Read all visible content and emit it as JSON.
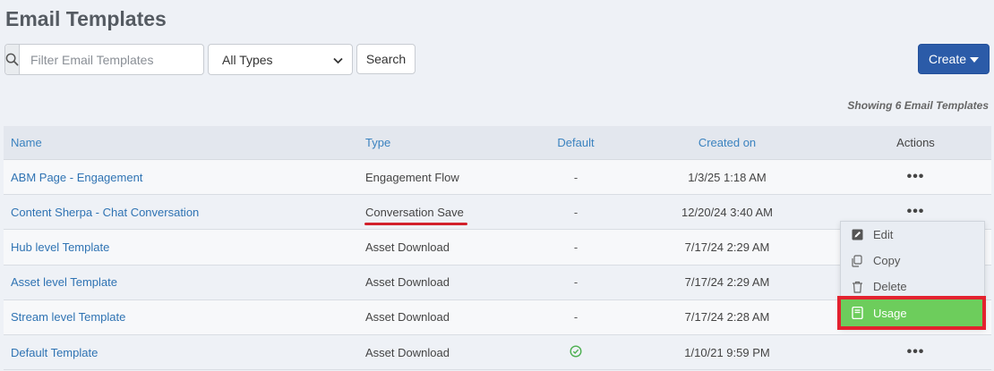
{
  "page": {
    "title": "Email Templates"
  },
  "toolbar": {
    "search_placeholder": "Filter Email Templates",
    "type_select_value": "All Types",
    "search_label": "Search",
    "create_label": "Create"
  },
  "count_text": "Showing 6 Email Templates",
  "table": {
    "headers": {
      "name": "Name",
      "type": "Type",
      "default": "Default",
      "created": "Created on",
      "actions": "Actions"
    },
    "rows": [
      {
        "name": "ABM Page - Engagement",
        "type": "Engagement Flow",
        "default": "-",
        "created": "1/3/25 1:18 AM",
        "actions": "•••"
      },
      {
        "name": "Content Sherpa - Chat Conversation",
        "type": "Conversation Save",
        "default": "-",
        "created": "12/20/24 3:40 AM",
        "actions": "•••"
      },
      {
        "name": "Hub level Template",
        "type": "Asset Download",
        "default": "-",
        "created": "7/17/24 2:29 AM",
        "actions": ""
      },
      {
        "name": "Asset level Template",
        "type": "Asset Download",
        "default": "-",
        "created": "7/17/24 2:29 AM",
        "actions": ""
      },
      {
        "name": "Stream level Template",
        "type": "Asset Download",
        "default": "-",
        "created": "7/17/24 2:28 AM",
        "actions": ""
      },
      {
        "name": "Default Template",
        "type": "Asset Download",
        "default": "",
        "created": "1/10/21 9:59 PM",
        "actions": "•••"
      }
    ]
  },
  "menu": {
    "items": [
      {
        "label": "Edit",
        "icon": "edit-icon"
      },
      {
        "label": "Copy",
        "icon": "copy-icon"
      },
      {
        "label": "Delete",
        "icon": "trash-icon"
      },
      {
        "label": "Usage",
        "icon": "book-icon"
      }
    ]
  },
  "colors": {
    "accent": "#2b5ba8",
    "link": "#2f73b3",
    "usage_highlight": "#6dcd5c",
    "annotation_red": "#d2212b",
    "default_check": "#4caf50"
  }
}
